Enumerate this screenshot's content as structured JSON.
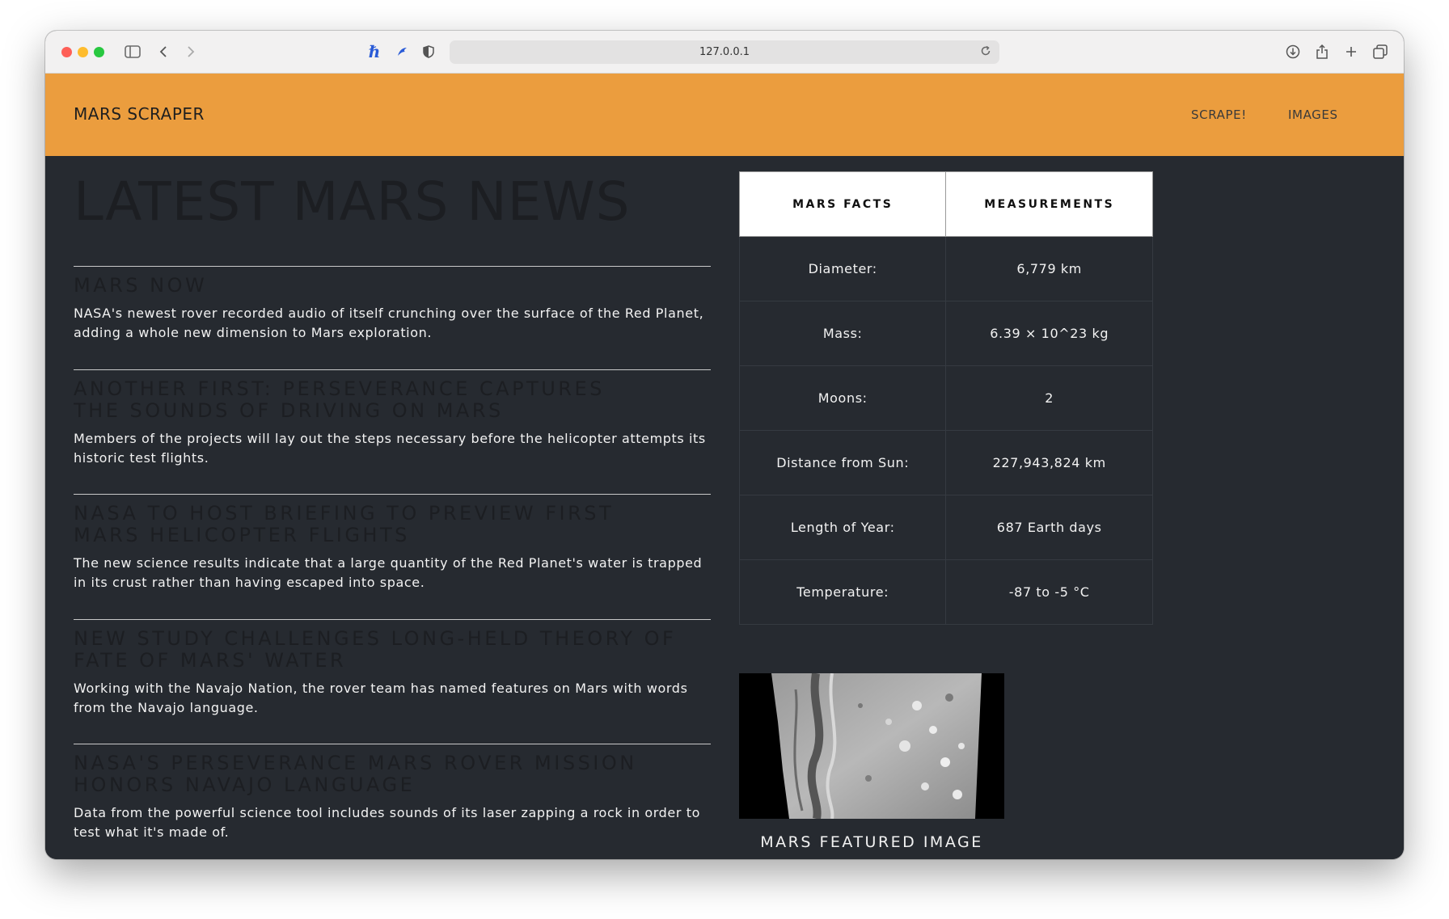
{
  "browser": {
    "url": "127.0.0.1",
    "icons": [
      "sidebar-icon",
      "back-icon",
      "forward-icon",
      "extension-h-icon",
      "extension-bird-icon",
      "shield-icon",
      "reload-icon",
      "download-icon",
      "share-icon",
      "new-tab-icon",
      "tabs-overview-icon"
    ]
  },
  "navbar": {
    "brand": "MARS SCRAPER",
    "links": [
      "SCRAPE!",
      "IMAGES"
    ],
    "background_color": "#eb9d3e"
  },
  "news": {
    "heading": "LATEST MARS NEWS",
    "items": [
      {
        "title": "MARS NOW",
        "body": "NASA's newest rover recorded audio of itself crunching over the surface of the Red Planet, adding a whole new dimension to Mars exploration."
      },
      {
        "title": "ANOTHER FIRST: PERSEVERANCE CAPTURES THE SOUNDS OF DRIVING ON MARS",
        "body": "Members of the projects will lay out the steps necessary before the helicopter attempts its historic test flights."
      },
      {
        "title": "NASA TO HOST BRIEFING TO PREVIEW FIRST MARS HELICOPTER FLIGHTS",
        "body": "The new science results indicate that a large quantity of the Red Planet's water is trapped in its crust rather than having escaped into space."
      },
      {
        "title": "NEW STUDY CHALLENGES LONG-HELD THEORY OF FATE OF MARS' WATER",
        "body": "Working with the Navajo Nation, the rover team has named features on Mars with words from the Navajo language."
      },
      {
        "title": "NASA'S PERSEVERANCE MARS ROVER MISSION HONORS NAVAJO LANGUAGE",
        "body": "Data from the powerful science tool includes sounds of its laser zapping a rock in order to test what it's made of."
      }
    ]
  },
  "facts": {
    "headers": [
      "MARS FACTS",
      "MEASUREMENTS"
    ],
    "rows": [
      [
        "Diameter:",
        "6,779 km"
      ],
      [
        "Mass:",
        "6.39 × 10^23 kg"
      ],
      [
        "Moons:",
        "2"
      ],
      [
        "Distance from Sun:",
        "227,943,824 km"
      ],
      [
        "Length of Year:",
        "687 Earth days"
      ],
      [
        "Temperature:",
        "-87 to -5 °C"
      ]
    ]
  },
  "featured": {
    "caption": "MARS FEATURED IMAGE"
  }
}
